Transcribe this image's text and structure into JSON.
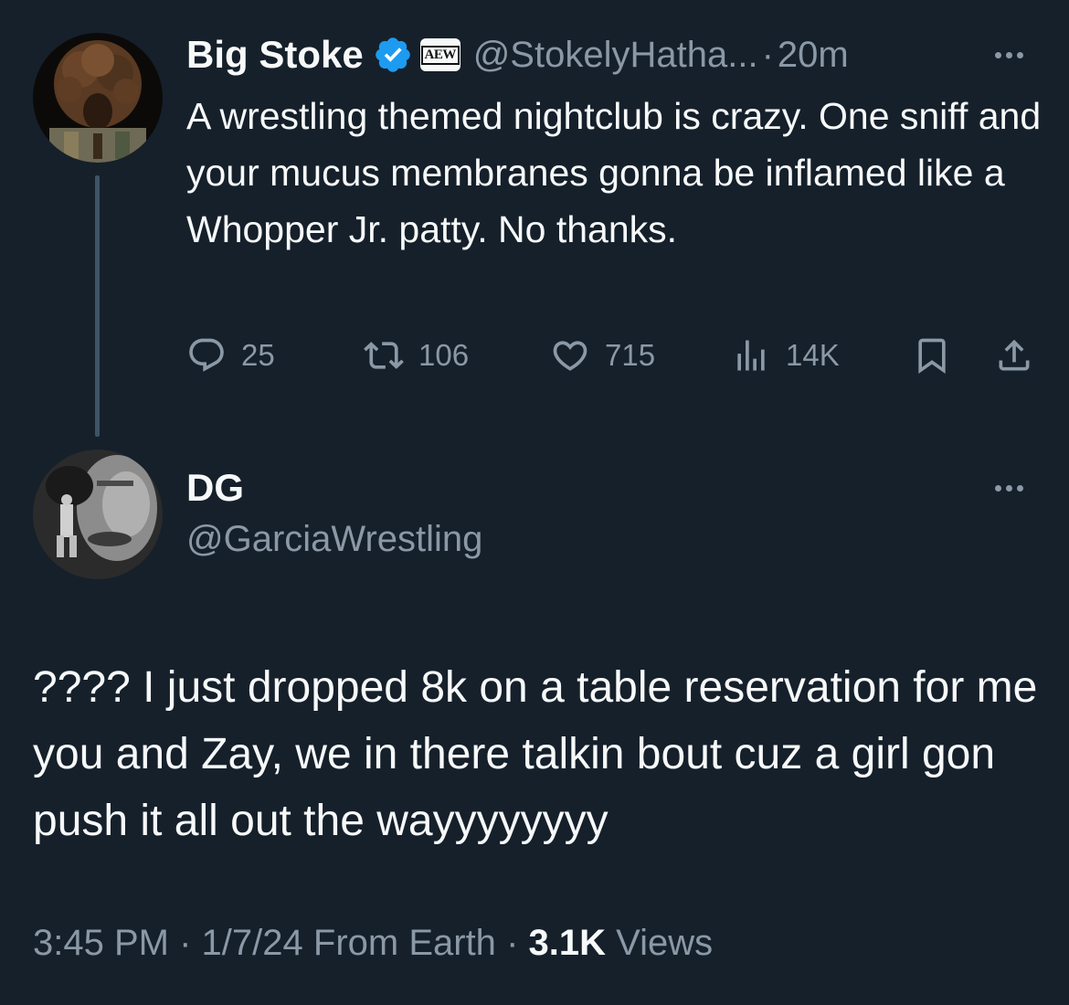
{
  "tweet": {
    "author_name": "Big Stoke",
    "handle": "@StokelyHatha...",
    "affiliate_badge": "AEW",
    "separator": "·",
    "time": "20m",
    "text": "A wrestling themed nightclub is crazy. One sniff and your mucus membranes gonna be inflamed like a Whopper Jr. patty. No thanks.",
    "replies": "25",
    "retweets": "106",
    "likes": "715",
    "views": "14K"
  },
  "reply": {
    "author_name": "DG",
    "handle": "@GarciaWrestling",
    "text": "???? I just dropped 8k on a table reservation for me you and Zay, we in there talkin bout cuz a girl gon push it all out the wayyyyyyyy",
    "time": "3:45 PM",
    "date": "1/7/24",
    "source": "From Earth",
    "views_count": "3.1K",
    "views_label": "Views",
    "separator": "·"
  },
  "icons": [
    "verified-badge-icon",
    "aff-badge-icon",
    "more-icon",
    "reply-icon",
    "retweet-icon",
    "like-icon",
    "views-icon",
    "bookmark-icon",
    "share-icon"
  ],
  "colors": {
    "background": "#15202b",
    "text": "#f7f9f9",
    "muted": "#8b98a5",
    "verified": "#1d9bf0",
    "thread_line": "#3d5466"
  }
}
